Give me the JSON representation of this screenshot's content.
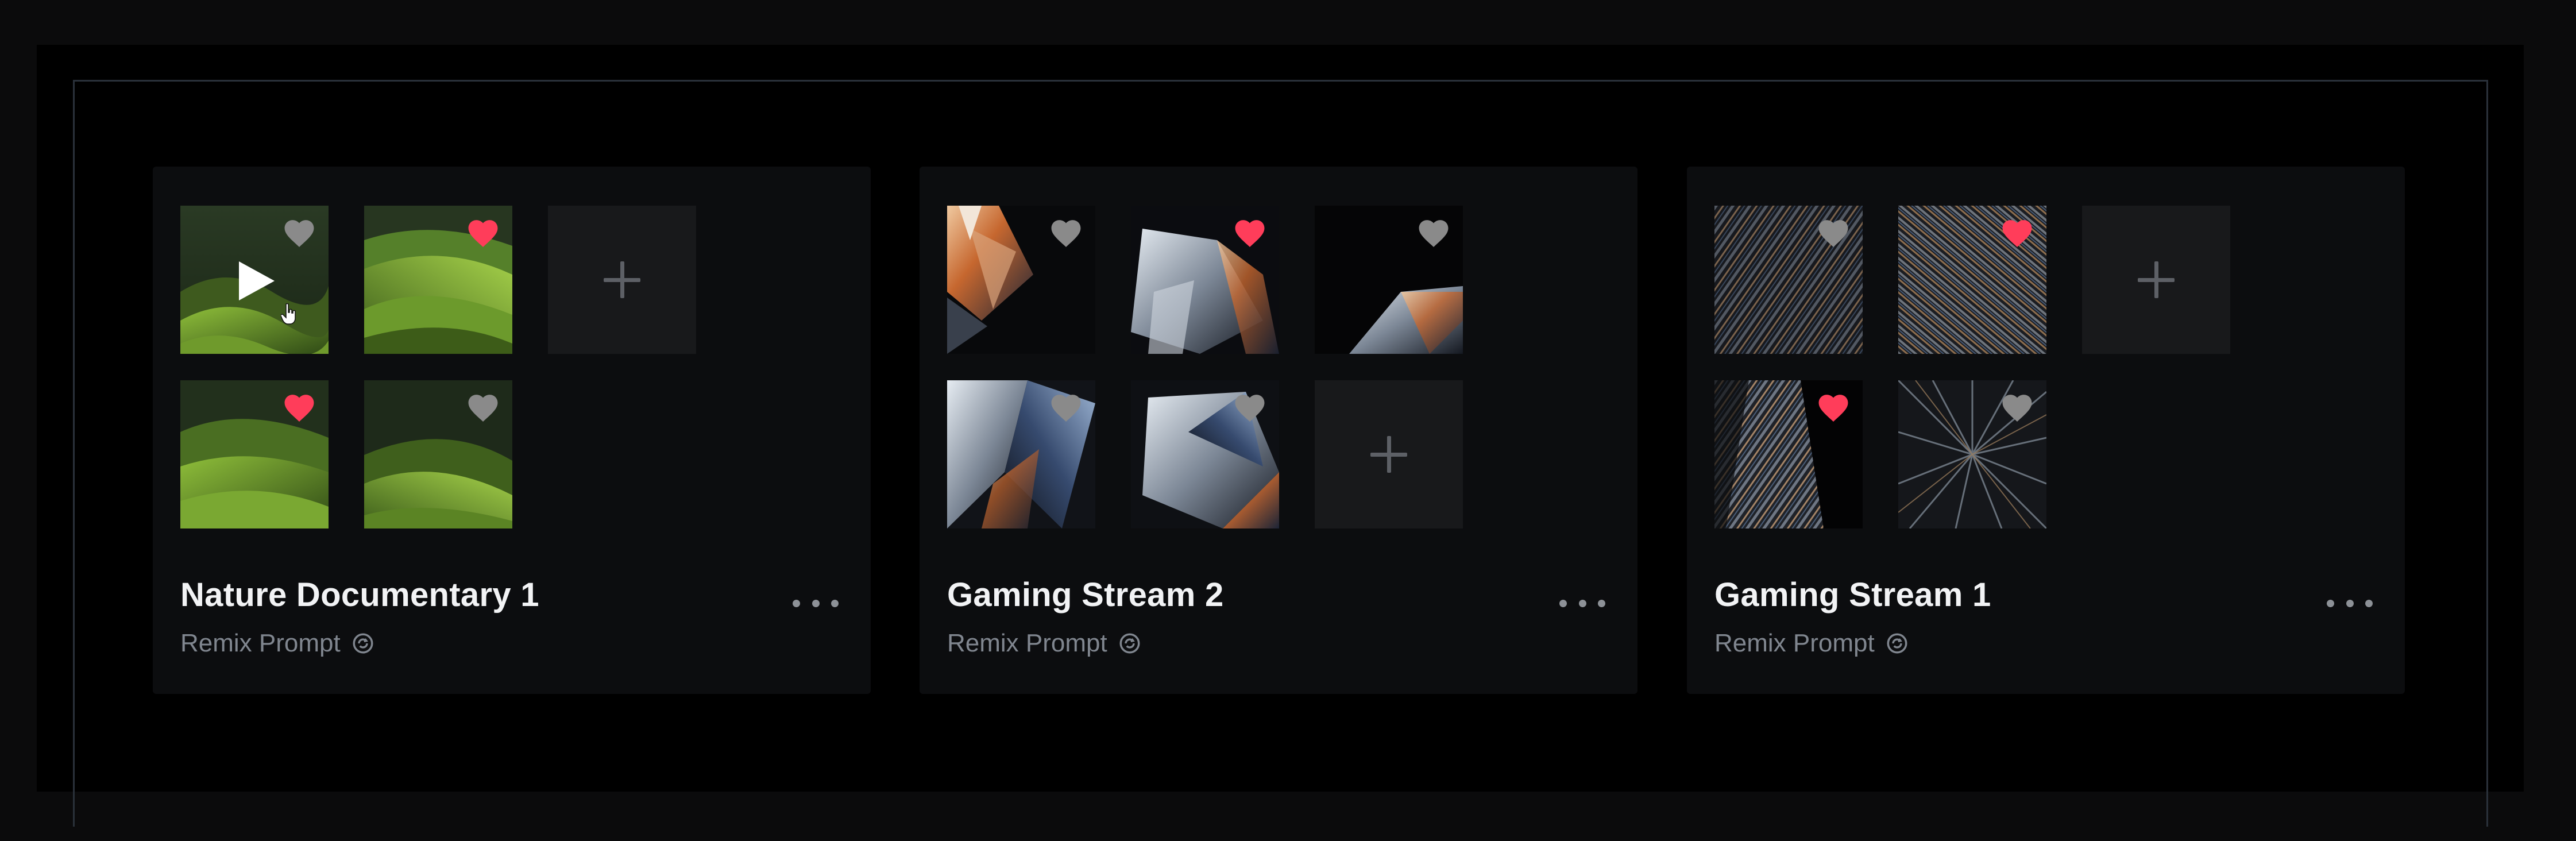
{
  "colors": {
    "background": "#0b0b0c",
    "card": "#0c0d0f",
    "heart_active": "#ff3d5a",
    "heart_inactive": "#8a8a8a",
    "title": "#f2f3f5",
    "subtitle": "#80868f"
  },
  "cards": [
    {
      "title": "Nature Documentary 1",
      "subtitle": "Remix Prompt",
      "thumbnails": [
        {
          "theme": "green-hills",
          "liked": false,
          "playing": true
        },
        {
          "theme": "green-hills",
          "liked": true
        },
        {
          "type": "add"
        },
        {
          "theme": "green-hills",
          "liked": true
        },
        {
          "theme": "green-hills",
          "liked": false
        }
      ]
    },
    {
      "title": "Gaming Stream 2",
      "subtitle": "Remix Prompt",
      "thumbnails": [
        {
          "theme": "crystal-shards",
          "liked": false
        },
        {
          "theme": "crystal-shards",
          "liked": true
        },
        {
          "theme": "crystal-shards",
          "liked": false
        },
        {
          "theme": "crystal-shards",
          "liked": false
        },
        {
          "theme": "crystal-shards",
          "liked": false
        },
        {
          "type": "add"
        }
      ]
    },
    {
      "title": "Gaming Stream 1",
      "subtitle": "Remix Prompt",
      "thumbnails": [
        {
          "theme": "crystal-texture",
          "liked": false
        },
        {
          "theme": "crystal-texture",
          "liked": true
        },
        {
          "type": "add"
        },
        {
          "theme": "crystal-texture",
          "liked": true
        },
        {
          "theme": "crystal-texture",
          "liked": false
        }
      ]
    }
  ]
}
